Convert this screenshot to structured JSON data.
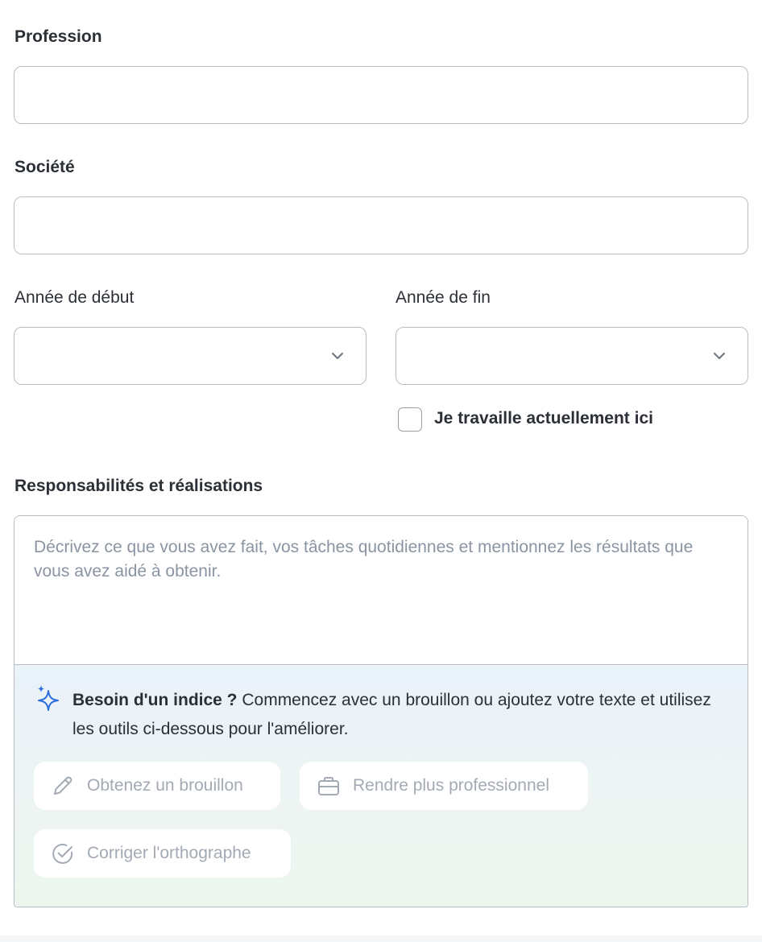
{
  "form": {
    "profession": {
      "label": "Profession",
      "value": ""
    },
    "company": {
      "label": "Société",
      "value": ""
    },
    "start_year": {
      "label": "Année de début",
      "value": ""
    },
    "end_year": {
      "label": "Année de fin",
      "value": ""
    },
    "currently_working": {
      "label": "Je travaille actuellement ici",
      "checked": false
    },
    "responsibilities": {
      "label": "Responsabilités et réalisations",
      "placeholder": "Décrivez ce que vous avez fait, vos tâches quotidiennes et mentionnez les résultats que vous avez aidé à obtenir.",
      "value": ""
    }
  },
  "hint": {
    "title": "Besoin d'un indice ?",
    "text": " Commencez avec un brouillon ou ajoutez votre texte et utilisez les outils ci-dessous pour l'améliorer.",
    "icon": "sparkle-icon",
    "accent_color": "#2f6fdb"
  },
  "tools": {
    "draft": {
      "label": "Obtenez un brouillon",
      "icon": "pencil-icon"
    },
    "professional": {
      "label": "Rendre plus professionnel",
      "icon": "briefcase-icon"
    },
    "spelling": {
      "label": "Corriger l'orthographe",
      "icon": "check-circle-icon"
    }
  }
}
